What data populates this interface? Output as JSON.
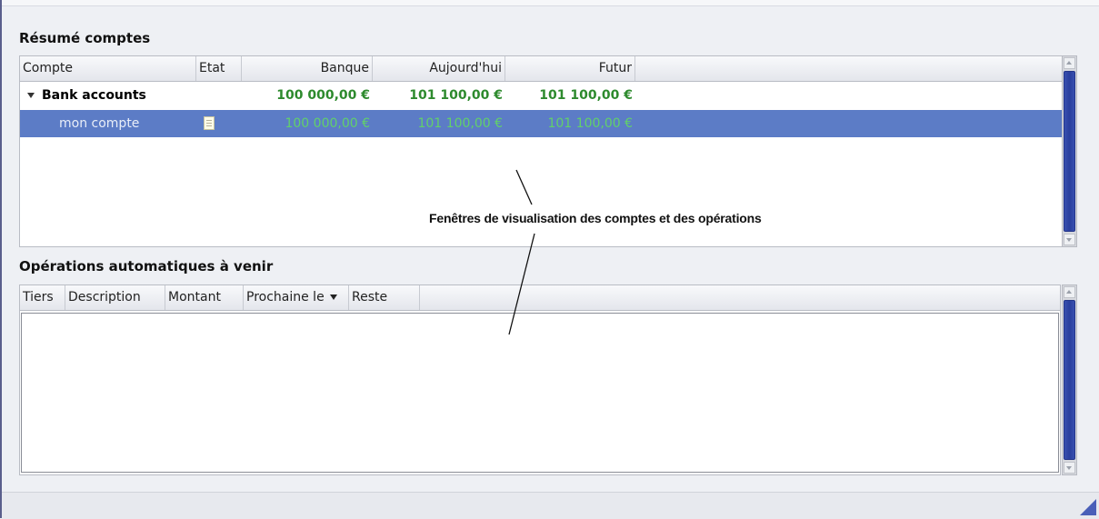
{
  "summary": {
    "title": "Résumé comptes",
    "columns": [
      "Compte",
      "Etat",
      "Banque",
      "Aujourd'hui",
      "Futur"
    ],
    "group": {
      "name": "Bank accounts",
      "banque": "100 000,00 €",
      "aujourdhui": "101 100,00 €",
      "futur": "101 100,00 €"
    },
    "account": {
      "name": "mon compte",
      "state_icon": "note-icon",
      "banque": "100 000,00 €",
      "aujourdhui": "101 100,00 €",
      "futur": "101 100,00 €"
    }
  },
  "scheduled": {
    "title": "Opérations automatiques à venir",
    "columns": [
      "Tiers",
      "Description",
      "Montant",
      "Prochaine le",
      "Reste"
    ],
    "sorted_column_icon": "sort-down-icon"
  },
  "annotation": {
    "text": "Fenêtres de visualisation des comptes et des opérations"
  },
  "colors": {
    "accent": "#5c7cc6",
    "amount_green": "#2d8a2d",
    "scroll_thumb": "#2a3f9e"
  }
}
